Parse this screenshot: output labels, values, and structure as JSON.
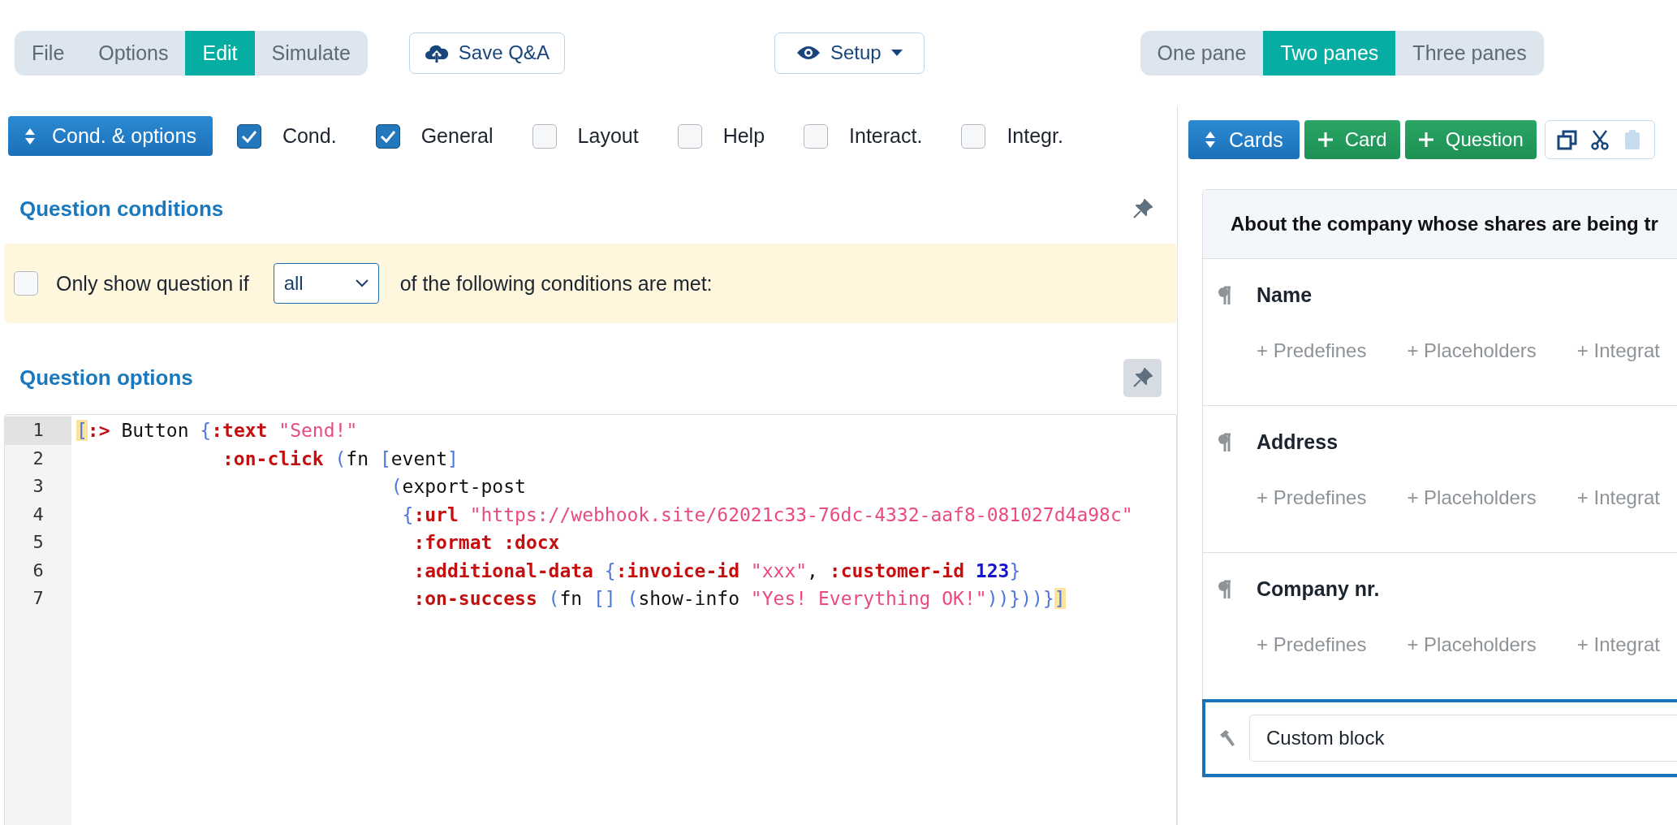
{
  "menu_tabs": [
    {
      "label": "File",
      "selected": false
    },
    {
      "label": "Options",
      "selected": false
    },
    {
      "label": "Edit",
      "selected": true
    },
    {
      "label": "Simulate",
      "selected": false
    }
  ],
  "save_button": "Save Q&A",
  "setup_button": "Setup",
  "pane_tabs": [
    {
      "label": "One pane",
      "selected": false
    },
    {
      "label": "Two panes",
      "selected": true
    },
    {
      "label": "Three panes",
      "selected": false
    }
  ],
  "options_toggle": "Cond. & options",
  "section_filters": [
    {
      "label": "Cond.",
      "checked": true
    },
    {
      "label": "General",
      "checked": true
    },
    {
      "label": "Layout",
      "checked": false
    },
    {
      "label": "Help",
      "checked": false
    },
    {
      "label": "Interact.",
      "checked": false
    },
    {
      "label": "Integr.",
      "checked": false
    }
  ],
  "conditions": {
    "title": "Question conditions",
    "pinned": false,
    "checked": false,
    "prefix": "Only show question if",
    "select_value": "all",
    "suffix": "of the following conditions are met:"
  },
  "options": {
    "title": "Question options",
    "pinned": true,
    "code_lines": [
      {
        "number": "1",
        "active": true,
        "tokens": [
          {
            "kind": "match",
            "text": "["
          },
          {
            "kind": "keyword",
            "text": ":>"
          },
          {
            "kind": "plain",
            "text": " Button "
          },
          {
            "kind": "bracket",
            "text": "{"
          },
          {
            "kind": "keyword",
            "text": ":text"
          },
          {
            "kind": "string",
            "text": " \"Send!\""
          }
        ]
      },
      {
        "number": "2",
        "active": false,
        "tokens": [
          {
            "kind": "keyword",
            "text": "             :on-click"
          },
          {
            "kind": "bracket",
            "text": " ("
          },
          {
            "kind": "plain",
            "text": "fn "
          },
          {
            "kind": "bracket",
            "text": "["
          },
          {
            "kind": "plain",
            "text": "event"
          },
          {
            "kind": "bracket",
            "text": "]"
          }
        ]
      },
      {
        "number": "3",
        "active": false,
        "tokens": [
          {
            "kind": "bracket",
            "text": "                            ("
          },
          {
            "kind": "plain",
            "text": "export-post"
          }
        ]
      },
      {
        "number": "4",
        "active": false,
        "tokens": [
          {
            "kind": "bracket",
            "text": "                             {"
          },
          {
            "kind": "keyword",
            "text": ":url"
          },
          {
            "kind": "string",
            "text": " \"https://webhook.site/62021c33-76dc-4332-aaf8-081027d4a98c\""
          }
        ]
      },
      {
        "number": "5",
        "active": false,
        "tokens": [
          {
            "kind": "keyword",
            "text": "                              :format :docx"
          }
        ]
      },
      {
        "number": "6",
        "active": false,
        "tokens": [
          {
            "kind": "keyword",
            "text": "                              :additional-data"
          },
          {
            "kind": "bracket",
            "text": " {"
          },
          {
            "kind": "keyword",
            "text": ":invoice-id"
          },
          {
            "kind": "string",
            "text": " \"xxx\""
          },
          {
            "kind": "plain",
            "text": ", "
          },
          {
            "kind": "keyword",
            "text": ":customer-id"
          },
          {
            "kind": "number",
            "text": " 123"
          },
          {
            "kind": "bracket",
            "text": "}"
          }
        ]
      },
      {
        "number": "7",
        "active": false,
        "tokens": [
          {
            "kind": "keyword",
            "text": "                              :on-success"
          },
          {
            "kind": "bracket",
            "text": " ("
          },
          {
            "kind": "plain",
            "text": "fn "
          },
          {
            "kind": "bracket",
            "text": "[] ("
          },
          {
            "kind": "plain",
            "text": "show-info "
          },
          {
            "kind": "string",
            "text": "\"Yes! Everything OK!\""
          },
          {
            "kind": "bracket",
            "text": "))}))}"
          },
          {
            "kind": "match",
            "text": "]"
          }
        ]
      }
    ]
  },
  "right_toolbar": {
    "cards_button": "Cards",
    "add_buttons": [
      "Card",
      "Question"
    ],
    "clipboard_tools": [
      {
        "disabled": false
      },
      {
        "disabled": false
      },
      {
        "disabled": true
      }
    ]
  },
  "card": {
    "title": "About the company whose shares are being tr",
    "questions": [
      {
        "label": "Name",
        "links": [
          "+ Predefines",
          "+ Placeholders",
          "+ Integrat"
        ]
      },
      {
        "label": "Address",
        "links": [
          "+ Predefines",
          "+ Placeholders",
          "+ Integrat"
        ]
      },
      {
        "label": "Company nr.",
        "links": [
          "+ Predefines",
          "+ Placeholders",
          "+ Integrat"
        ]
      }
    ],
    "custom_block": {
      "value": "Custom block",
      "selected": true
    }
  }
}
